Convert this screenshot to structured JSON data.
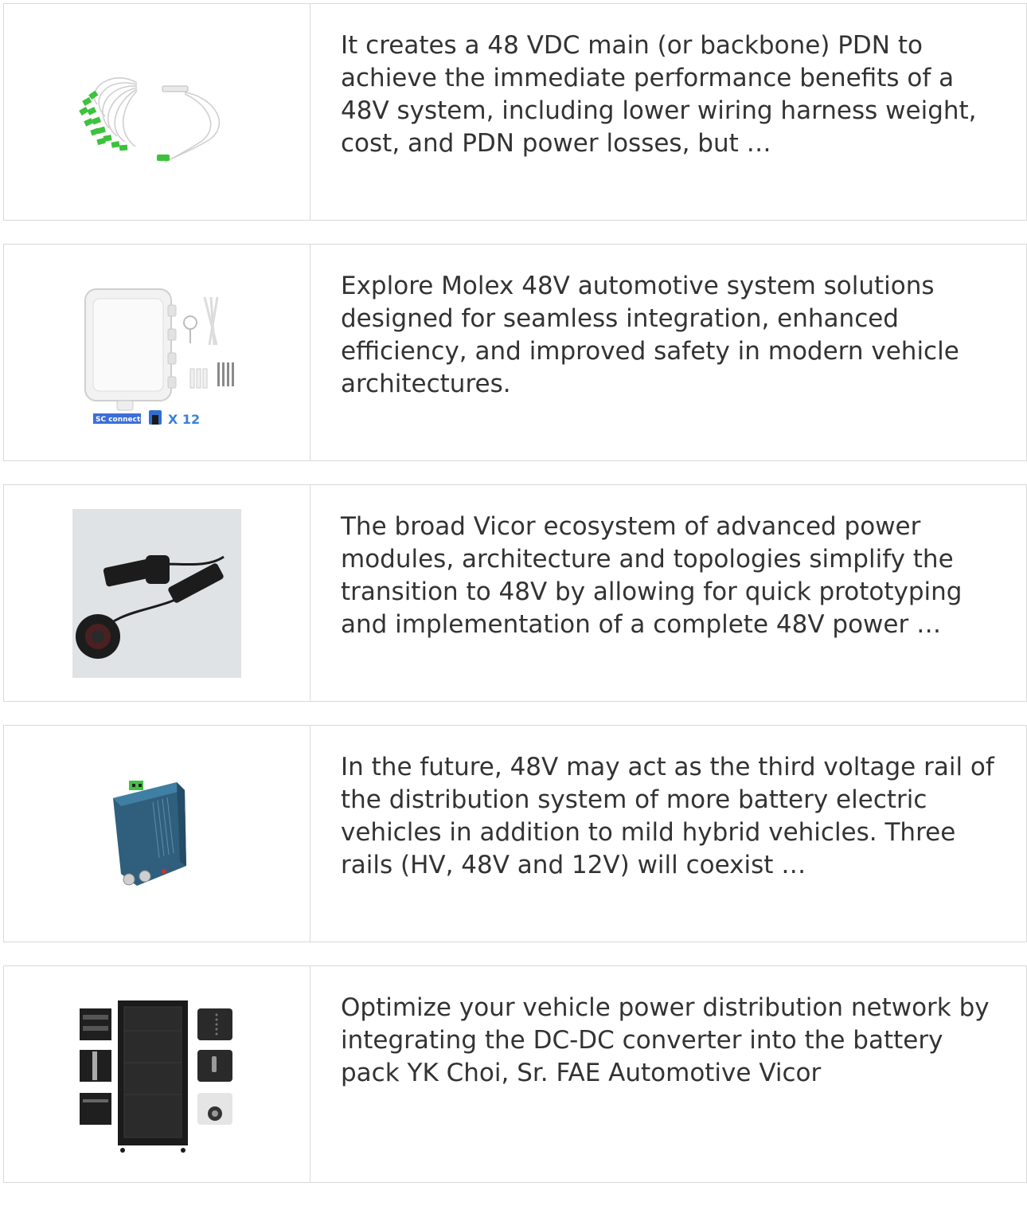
{
  "items": [
    {
      "image": "fiber-optic-plc-splitter",
      "description": "It creates a 48 VDC main (or backbone) PDN to achieve the immediate performance benefits of a 48V system, including lower wiring harness weight, cost, and PDN power losses, but …"
    },
    {
      "image": "fiber-distribution-box",
      "image_caption_label": "SC connector",
      "image_caption_count": "X 12",
      "description": "Explore Molex 48V automotive system solutions designed for seamless integration, enhanced efficiency, and improved safety in modern vehicle architectures."
    },
    {
      "image": "waterproof-cable-connectors",
      "description": "The broad Vicor ecosystem of advanced power modules, architecture and topologies simplify the transition to 48V by allowing for quick prototyping and implementation of a complete 48V power …"
    },
    {
      "image": "optical-receiver",
      "description": "In the future, 48V may act as the third voltage rail of the distribution system of more battery electric vehicles in addition to mild hybrid vehicles. Three rails (HV, 48V and 12V) will coexist …"
    },
    {
      "image": "network-server-cabinet",
      "description": "Optimize your vehicle power distribution network by integrating the DC-DC converter into the battery pack YK Choi, Sr. FAE Automotive Vicor"
    }
  ],
  "colors": {
    "border": "#d9d9d9",
    "text": "#333333",
    "splitter_green": "#3cc23c",
    "receiver_blue": "#3b6f8f",
    "cabinet_black": "#1b1b1b",
    "caption_blue": "#3b82d6"
  }
}
